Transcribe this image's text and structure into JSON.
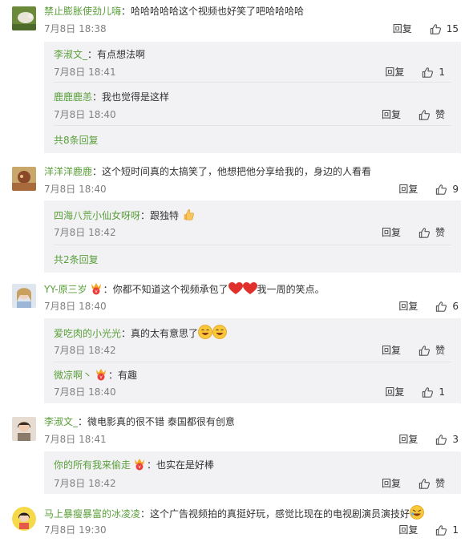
{
  "ui": {
    "reply": "回复",
    "like": "赞"
  },
  "comments": [
    {
      "user": "禁止膨胀使劲儿嗨",
      "text": "：哈哈哈哈哈这个视频也好笑了吧哈哈哈哈",
      "time": "7月8日 18:38",
      "likes": "15",
      "replies": [
        {
          "user": "李淑文_",
          "text": "：有点想法啊",
          "time": "7月8日 18:41",
          "likes": "1"
        },
        {
          "user": "鹿鹿鹿恙",
          "text": "：我也觉得是这样",
          "time": "7月8日 18:40",
          "likes": "赞"
        }
      ],
      "more": "共8条回复"
    },
    {
      "user": "洋洋洋鹿鹿",
      "text": "：这个短时间真的太搞笑了，他想把他分享给我的，身边的人看看",
      "time": "7月8日 18:40",
      "likes": "9",
      "replies": [
        {
          "user": "四海八荒小仙女呀呀",
          "text": "：跟独特",
          "time": "7月8日 18:42",
          "likes": "赞"
        }
      ],
      "more": "共2条回复"
    },
    {
      "user": "YY-原三岁",
      "text_a": "：你都不知道这个视频承包了",
      "text_b": "我一周的笑点。",
      "time": "7月8日 18:40",
      "likes": "6",
      "replies": [
        {
          "user": "爱吃肉的小光光",
          "text": "：真的太有意思了",
          "time": "7月8日 18:42",
          "likes": "赞"
        },
        {
          "user": "微凉啊丶",
          "text": "：有趣",
          "time": "7月8日 18:40",
          "likes": "1"
        }
      ]
    },
    {
      "user": "李淑文_",
      "text": "：微电影真的很不错 泰国都很有创意",
      "time": "7月8日 18:41",
      "likes": "3",
      "replies": [
        {
          "user": "你的所有我来偷走",
          "text": "：也实在是好棒",
          "time": "7月8日 18:42",
          "likes": "赞"
        }
      ]
    },
    {
      "user": "马上暴瘦暴富的冰凌凌",
      "text": "：这个广告视频拍的真挺好玩，感觉比现在的电视剧演员演技好",
      "time": "7月8日 19:30",
      "likes": "1"
    }
  ]
}
